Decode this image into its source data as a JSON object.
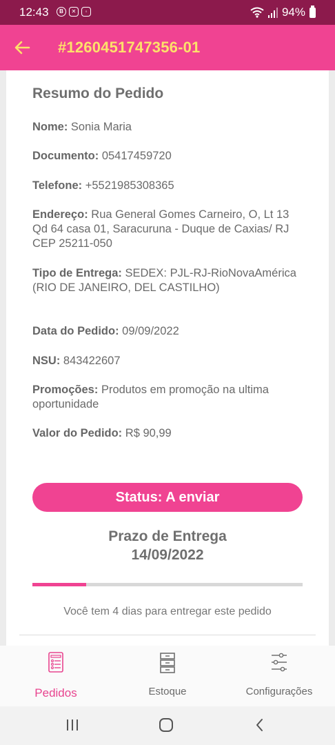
{
  "status_bar": {
    "time": "12:43",
    "battery": "94%"
  },
  "header": {
    "title": "#1260451747356-01"
  },
  "summary": {
    "title": "Resumo do Pedido",
    "fields": [
      {
        "label": "Nome:",
        "value": " Sonia Maria"
      },
      {
        "label": "Documento:",
        "value": " 05417459720"
      },
      {
        "label": "Telefone:",
        "value": " +5521985308365"
      },
      {
        "label": "Endereço:",
        "value": " Rua General Gomes Carneiro, O, Lt 13 Qd 64 casa 01, Saracuruna - Duque de Caxias/ RJ CEP 25211-050"
      },
      {
        "label": "Tipo de Entrega:",
        "value": " SEDEX: PJL-RJ-RioNovaAmérica (RIO DE JANEIRO, DEL CASTILHO)"
      },
      {
        "label": "Data do Pedido:",
        "value": " 09/09/2022"
      },
      {
        "label": "NSU:",
        "value": " 843422607"
      },
      {
        "label": "Promoções:",
        "value": " Produtos em promoção na ultima oportunidade"
      },
      {
        "label": "Valor do Pedido:",
        "value": " R$ 90,99"
      }
    ]
  },
  "status": {
    "label": "Status: A enviar"
  },
  "delivery": {
    "title": "Prazo de Entrega",
    "date": "14/09/2022",
    "progress": 0.2,
    "message": "Você tem 4 dias para entregar este pedido"
  },
  "bottom_nav": {
    "items": [
      {
        "label": "Pedidos",
        "icon": "orders-list-icon",
        "active": true
      },
      {
        "label": "Estoque",
        "icon": "inventory-drawers-icon",
        "active": false
      },
      {
        "label": "Configurações",
        "icon": "settings-sliders-icon",
        "active": false
      }
    ]
  },
  "colors": {
    "status_bar": "#8c1a4c",
    "accent": "#f04392",
    "title_text": "#fde16a"
  }
}
